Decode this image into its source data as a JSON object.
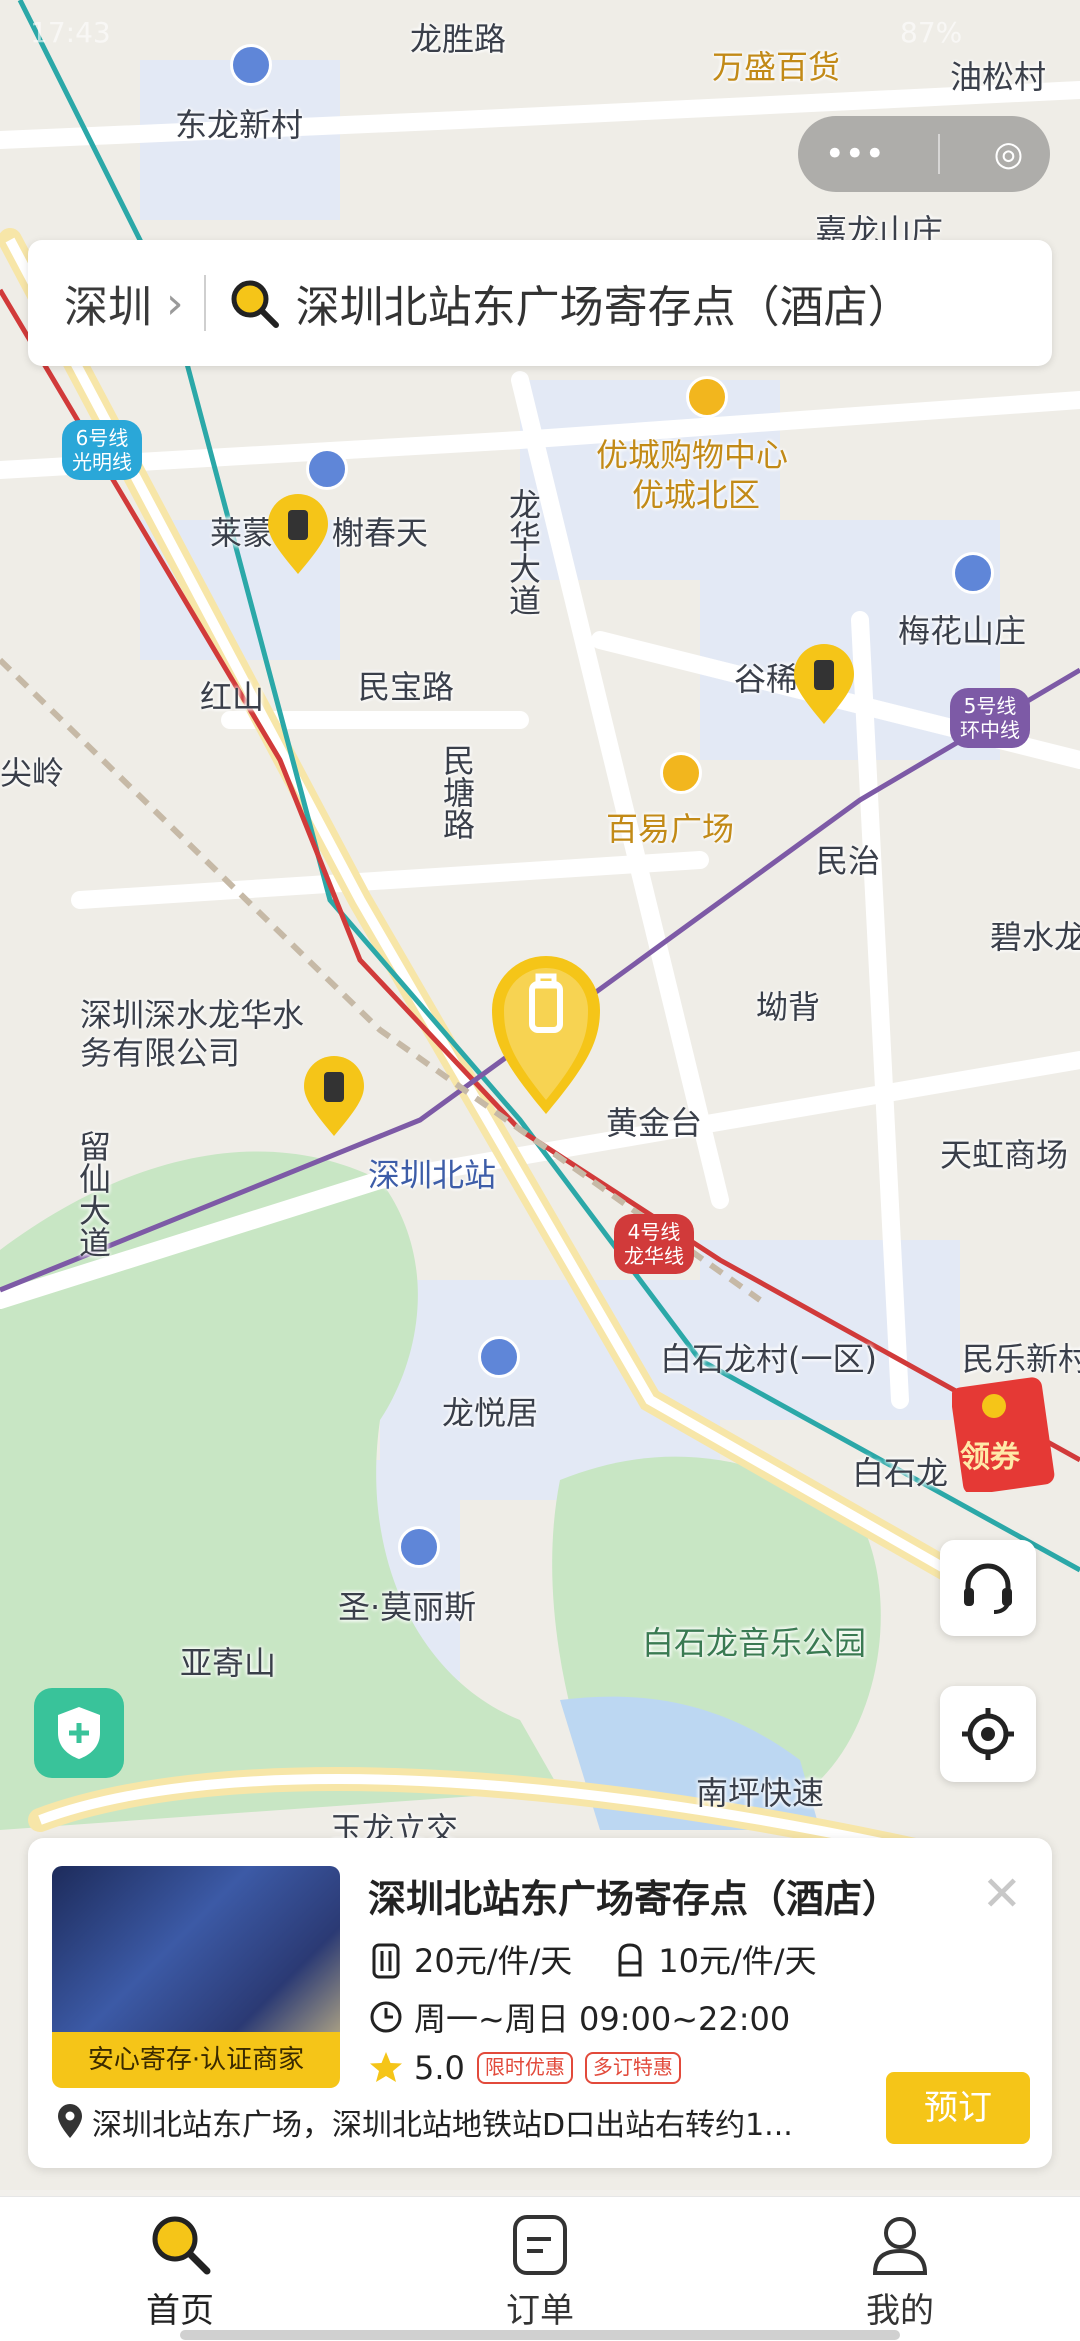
{
  "status_bar": {
    "time": "17:43",
    "battery": "87%"
  },
  "search": {
    "city": "深圳",
    "query": "深圳北站东广场寄存点（酒店）"
  },
  "map": {
    "labels": {
      "longsheng_road": "龙胜路",
      "wansheng": "万盛百货",
      "yousong": "油松村",
      "donglong": "东龙新村",
      "jialong": "嘉龙山庄",
      "youcheng": "优城购物中心",
      "youcheng_north": "优城北区",
      "laike": "莱蒙",
      "shuchuntian": "榭春天",
      "longhua_ave": "龙华大道",
      "meihua": "梅花山庄",
      "hongshan": "红山",
      "minbao": "民宝路",
      "guhe": "谷稀",
      "mintang": "民塘路",
      "baiyi": "百易广场",
      "minzhi": "民治",
      "bishui": "碧水龙",
      "jianling": "尖岭",
      "water_company": "深圳深水龙华水务有限公司",
      "aobei": "坳背",
      "huangjintai": "黄金台",
      "tianhong": "天虹商场",
      "shenzhen_north": "深圳北站",
      "liuxian": "留仙大道",
      "baishilong_1": "白石龙村(一区)",
      "minle": "民乐新村",
      "longyue": "龙悦居",
      "baishilong": "白石龙",
      "shengmolisi": "圣·莫丽斯",
      "yajishan": "亚寄山",
      "music_park": "白石龙音乐公园",
      "nanping": "南坪快速",
      "yulong": "玉龙立交"
    },
    "lines": {
      "line6": "6号线\n光明线",
      "line5": "5号线\n环中线",
      "line4": "4号线\n龙华线"
    },
    "coupon": "领券"
  },
  "card": {
    "title": "深圳北站东广场寄存点（酒店）",
    "badge": "安心寄存·认证商家",
    "price_large": "20元/件/天",
    "price_small": "10元/件/天",
    "hours": "周一~周日 09:00~22:00",
    "rating": "5.0",
    "tags": [
      "限时优惠",
      "多订特惠"
    ],
    "address": "深圳北站东广场，深圳北站地铁站D口出站右转约1...",
    "book": "预订",
    "colors": {
      "accent": "#f5c518",
      "tag": "#e24a3b"
    }
  },
  "tabbar": {
    "items": [
      {
        "label": "首页",
        "icon": "search-icon"
      },
      {
        "label": "订单",
        "icon": "order-icon"
      },
      {
        "label": "我的",
        "icon": "user-icon"
      }
    ]
  }
}
